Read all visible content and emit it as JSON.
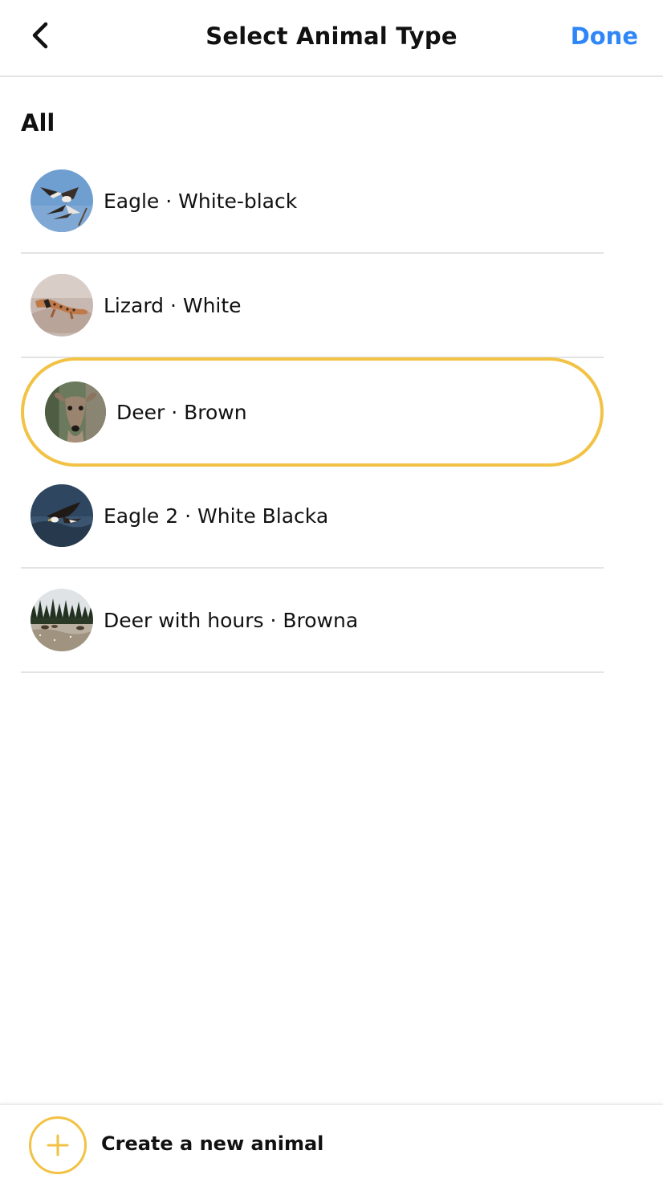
{
  "header": {
    "back_icon": "chevron-left-icon",
    "title": "Select Animal Type",
    "done_label": "Done",
    "done_color": "#2f86f6"
  },
  "section": {
    "title": "All"
  },
  "animals": [
    {
      "label": "Eagle · White-black",
      "thumbnail": "eagle-photo",
      "selected": false
    },
    {
      "label": "Lizard · White",
      "thumbnail": "lizard-photo",
      "selected": false
    },
    {
      "label": "Deer · Brown",
      "thumbnail": "deer-photo",
      "selected": true
    },
    {
      "label": "Eagle 2 · White Blacka",
      "thumbnail": "eagle-2-photo",
      "selected": false
    },
    {
      "label": "Deer with hours · Browna",
      "thumbnail": "deer-herd-photo",
      "selected": false
    }
  ],
  "footer": {
    "create_icon": "plus-icon",
    "create_label": "Create a new animal"
  },
  "colors": {
    "accent": "#f2c244",
    "link": "#2f86f6",
    "divider": "#e3e3e3"
  }
}
